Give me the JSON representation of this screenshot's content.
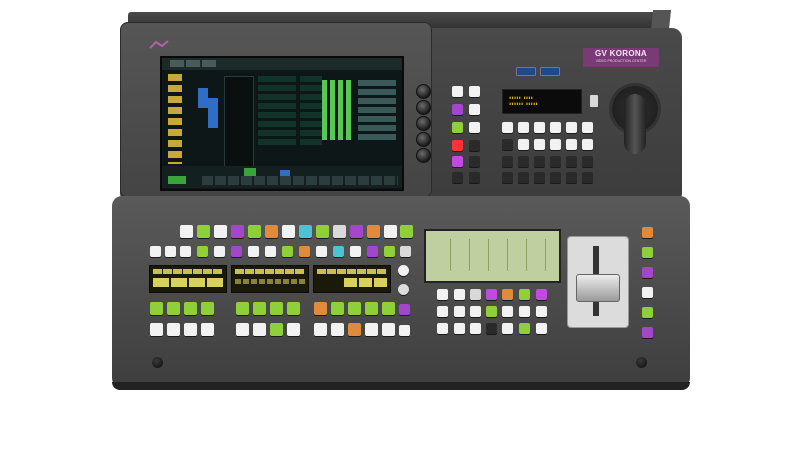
{
  "device": {
    "brand_title": "GV KORONA",
    "brand_subtitle": "VIDEO PRODUCTION CENTER"
  },
  "colors": {
    "chassis": "#3e3e3e",
    "brand_panel": "#7a3a75",
    "button_green": "#8ecf3a",
    "button_purple": "#a247c9",
    "button_orange": "#e08a3c",
    "button_cyan": "#4fc1d4",
    "button_white": "#f2f2f2",
    "display_amber": "#d8d25a"
  }
}
